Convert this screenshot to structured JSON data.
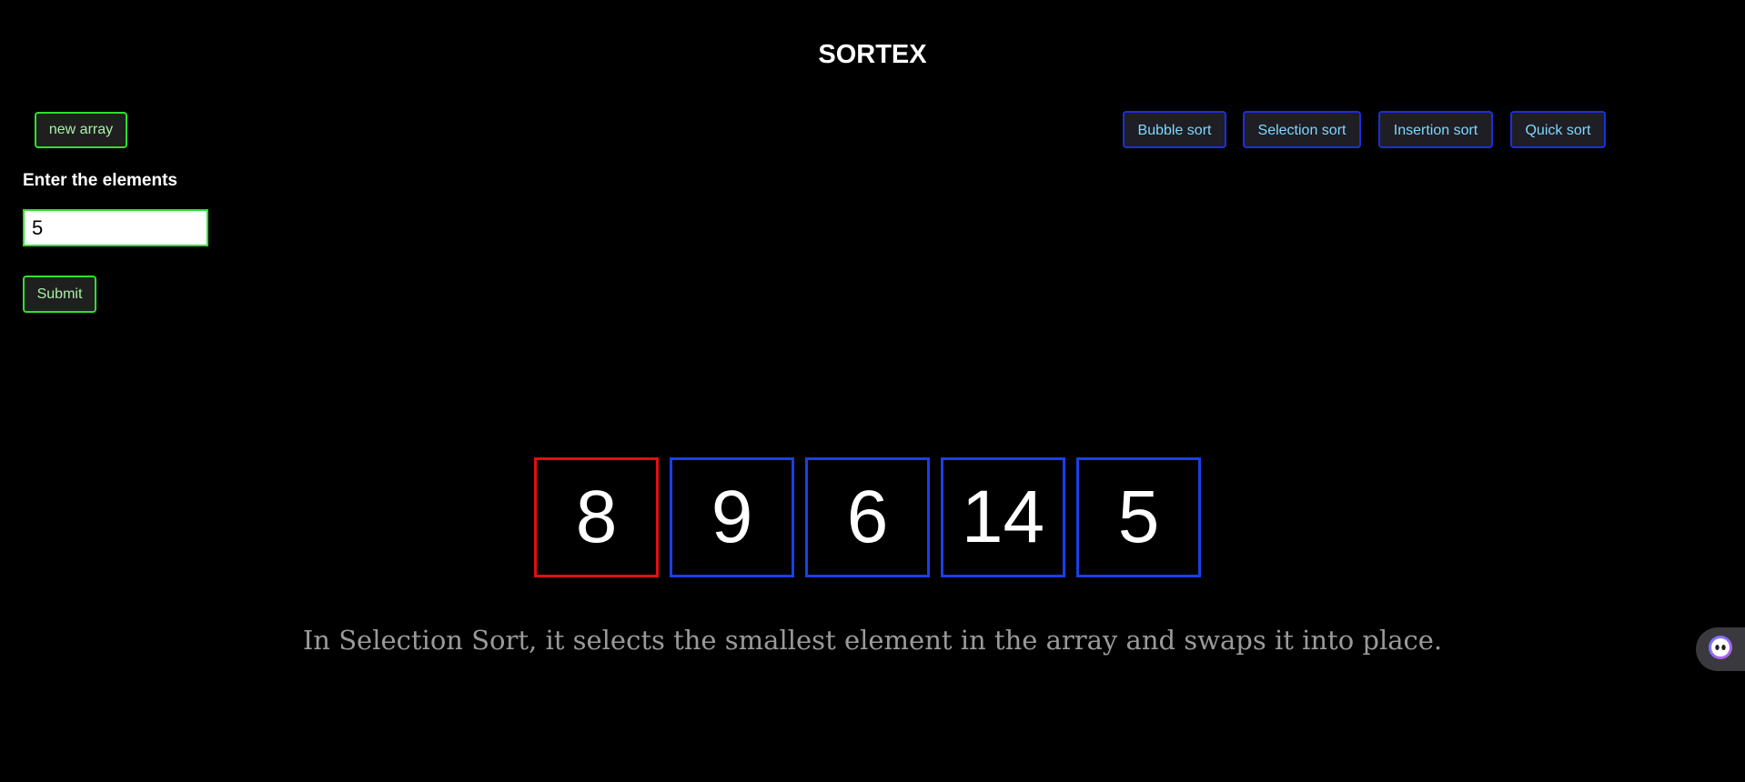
{
  "header": {
    "title": "SORTEX"
  },
  "controls": {
    "new_array_label": "new array",
    "enter_label": "Enter the elements",
    "count_input_value": "5",
    "submit_label": "Submit"
  },
  "algorithms": [
    {
      "label": "Bubble sort"
    },
    {
      "label": "Selection sort"
    },
    {
      "label": "Insertion sort"
    },
    {
      "label": "Quick sort"
    }
  ],
  "array": {
    "values": [
      "8",
      "9",
      "6",
      "14",
      "5"
    ],
    "highlighted_index": 0
  },
  "description": "In Selection Sort, it selects the smallest element in the array and swaps it into place.",
  "colors": {
    "background": "#000000",
    "button_border_green": "#2ee02e",
    "sort_button_border": "#1a2fe0",
    "cell_border": "#1a3fe8",
    "cell_highlight": "#e01010",
    "description_text": "#9a9a9a"
  },
  "widgets": {
    "assistant_icon": "assistant-face-icon"
  }
}
